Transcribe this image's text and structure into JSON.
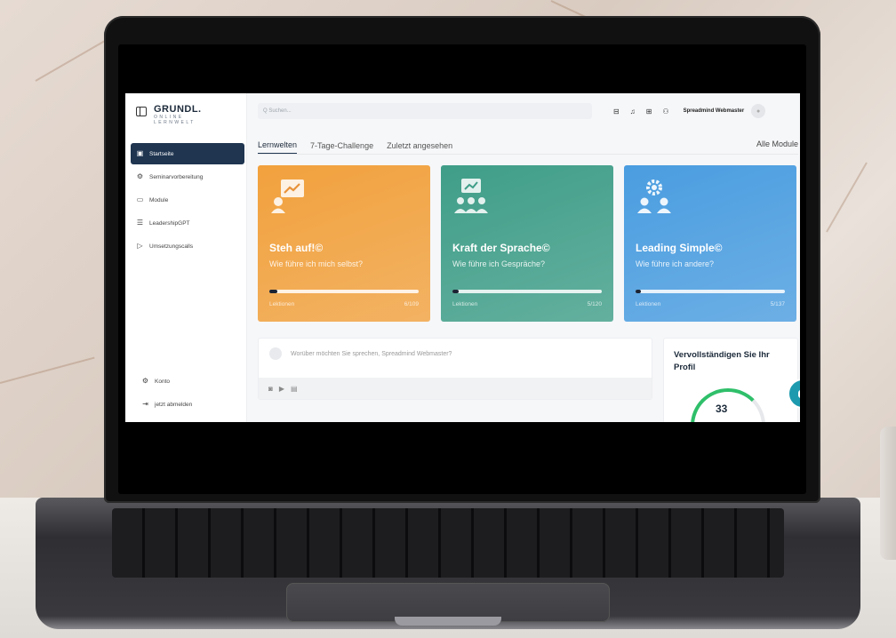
{
  "logo": {
    "main": "GRUNDL.",
    "sub_top": "ONLINE",
    "sub_bottom": "LERNWELT"
  },
  "sidebar": {
    "items": [
      {
        "label": "Startseite",
        "icon": "home-icon",
        "active": true
      },
      {
        "label": "Seminarvorbereitung",
        "icon": "seminar-icon"
      },
      {
        "label": "Module",
        "icon": "module-icon"
      },
      {
        "label": "LeadershipGPT",
        "icon": "list-icon"
      },
      {
        "label": "Umsetzungscalls",
        "icon": "video-icon"
      }
    ],
    "bottom": [
      {
        "label": "Konto",
        "icon": "gear-icon"
      },
      {
        "label": "jetzt abmelden",
        "icon": "logout-icon"
      }
    ]
  },
  "header": {
    "search_placeholder": "Q Suchen...",
    "user_name": "Spreadmind Webmaster"
  },
  "tabs": [
    {
      "label": "Lernwelten",
      "active": true
    },
    {
      "label": "7-Tage-Challenge"
    },
    {
      "label": "Zuletzt angesehen"
    }
  ],
  "all_modules": "Alle Module",
  "cards": [
    {
      "title": "Steh auf!©",
      "subtitle": "Wie führe ich mich selbst?",
      "label": "Lektionen",
      "count": "6/109",
      "progress": 0.055,
      "color": "#f2a13d"
    },
    {
      "title": "Kraft der Sprache©",
      "subtitle": "Wie führe ich Gespräche?",
      "label": "Lektionen",
      "count": "5/120",
      "progress": 0.042,
      "color": "#3f9e88"
    },
    {
      "title": "Leading Simple©",
      "subtitle": "Wie führe ich andere?",
      "label": "Lektionen",
      "count": "5/137",
      "progress": 0.036,
      "color": "#4a9de0"
    }
  ],
  "post": {
    "placeholder": "Worüber möchten Sie sprechen, Spreadmind Webmaster?"
  },
  "profile": {
    "title": "Vervollständigen Sie Ihr Profil",
    "percent": "33",
    "percent_value": 33
  }
}
